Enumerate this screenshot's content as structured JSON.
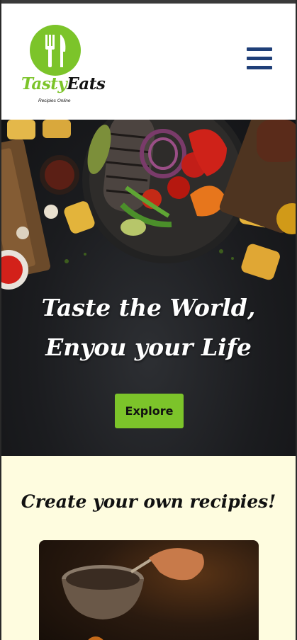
{
  "header": {
    "logo_word_1": "Tasty",
    "logo_word_2": "Eats",
    "logo_tagline": "Recipies Online",
    "menu_icon": "hamburger-menu-icon"
  },
  "hero": {
    "title": "Taste the World, Enyou your Life",
    "button_label": "Explore"
  },
  "section": {
    "title": "Create your own recipies!"
  },
  "colors": {
    "brand_green": "#7cc42a",
    "menu_blue": "#1f3f78",
    "section_bg": "#fefcdf"
  }
}
